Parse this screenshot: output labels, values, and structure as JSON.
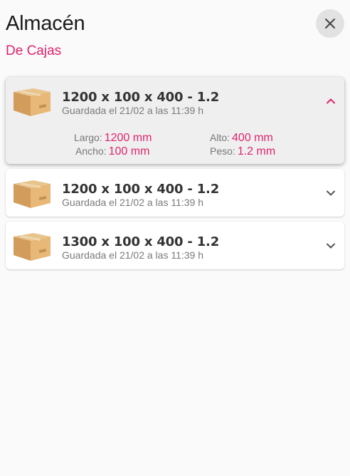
{
  "header": {
    "title": "Almacén",
    "subtitle": "De Cajas"
  },
  "icons": {
    "close": "close-icon",
    "box": "cardboard-box-icon",
    "expand": "chevron-down-icon",
    "collapse": "chevron-up-icon"
  },
  "colors": {
    "accent": "#e0246e",
    "background": "#fafafa",
    "card_expanded_bg": "#efefef"
  },
  "items": [
    {
      "title": "1200 x 100 x 400 - 1.2",
      "saved": "Guardada el 21/02 a las 11:39 h",
      "expanded": true,
      "details": {
        "largo_label": "Largo:",
        "largo_value": "1200 mm",
        "ancho_label": "Ancho:",
        "ancho_value": "100 mm",
        "alto_label": "Alto:",
        "alto_value": "400 mm",
        "peso_label": "Peso:",
        "peso_value": "1.2 mm"
      }
    },
    {
      "title": "1200 x 100 x 400 - 1.2",
      "saved": "Guardada el 21/02 a las 11:39 h",
      "expanded": false
    },
    {
      "title": "1300 x 100 x 400 - 1.2",
      "saved": "Guardada el 21/02 a las 11:39 h",
      "expanded": false
    }
  ]
}
